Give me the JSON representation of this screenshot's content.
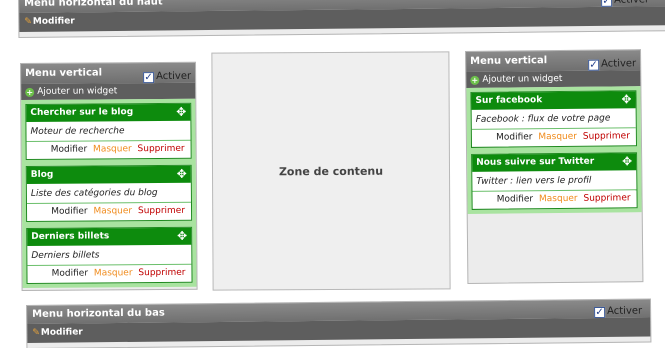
{
  "top_bar": {
    "title": "Menu horizontal du haut",
    "activer_label": "Activer",
    "modifier_label": "Modifier"
  },
  "bottom_bar": {
    "title": "Menu horizontal du bas",
    "activer_label": "Activer",
    "modifier_label": "Modifier"
  },
  "left_menu": {
    "title": "Menu vertical",
    "activer_label": "Activer",
    "add_widget_label": "Ajouter un widget",
    "widgets": [
      {
        "title": "Chercher sur le blog",
        "description": "Moteur de recherche",
        "modifier": "Modifier",
        "masquer": "Masquer",
        "supprimer": "Supprimer"
      },
      {
        "title": "Blog",
        "description": "Liste des catégories du blog",
        "modifier": "Modifier",
        "masquer": "Masquer",
        "supprimer": "Supprimer"
      },
      {
        "title": "Derniers billets",
        "description": "Derniers billets",
        "modifier": "Modifier",
        "masquer": "Masquer",
        "supprimer": "Supprimer"
      }
    ]
  },
  "right_menu": {
    "title": "Menu vertical",
    "activer_label": "Activer",
    "add_widget_label": "Ajouter un widget",
    "widgets": [
      {
        "title": "Sur facebook",
        "description": "Facebook : flux de votre page",
        "modifier": "Modifier",
        "masquer": "Masquer",
        "supprimer": "Supprimer"
      },
      {
        "title": "Nous suivre sur Twitter",
        "description": "Twitter : lien vers le profil",
        "modifier": "Modifier",
        "masquer": "Masquer",
        "supprimer": "Supprimer"
      }
    ]
  },
  "content_zone": {
    "label": "Zone de contenu"
  },
  "icons": {
    "checkbox": "checkbox-checked-icon",
    "pencil": "pencil-icon",
    "add": "plus-circle-icon",
    "move": "move-arrows-icon"
  },
  "colors": {
    "bar_gray": "#707070",
    "bar_dark": "#5e5e5e",
    "widget_green": "#0d8b0d",
    "panel_green": "#a9e3a0",
    "masquer_orange": "#f08c1e",
    "supprimer_red": "#c00000"
  }
}
